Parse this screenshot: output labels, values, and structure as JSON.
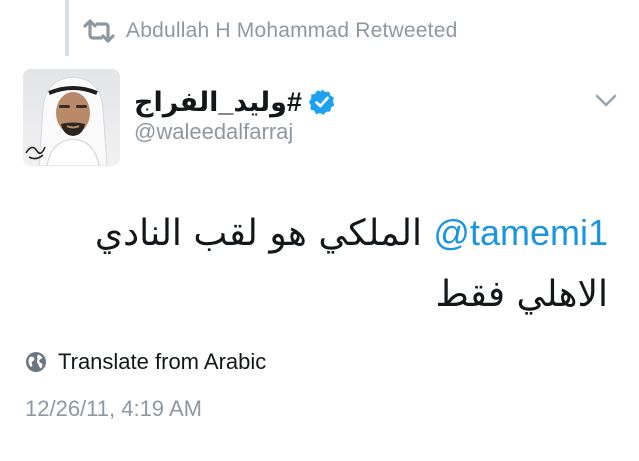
{
  "retweet": {
    "icon": "retweet-icon",
    "text": "Abdullah H Mohammad Retweeted"
  },
  "author": {
    "display_name": "#وليد_الفراج",
    "handle": "@waleedalfarraj",
    "verified": true,
    "avatar": "avatar-image"
  },
  "tweet": {
    "mention": "@tamemi1",
    "text": "الملكي هو لقب النادي الاهلي فقط"
  },
  "actions": {
    "more_icon": "chevron-down-icon"
  },
  "translate": {
    "icon": "globe-icon",
    "label": "Translate from Arabic"
  },
  "timestamp": "12/26/11, 4:19 AM",
  "colors": {
    "link": "#1b95e0",
    "muted": "#8f98a0",
    "text": "#14171a",
    "verified": "#1da1f2"
  }
}
